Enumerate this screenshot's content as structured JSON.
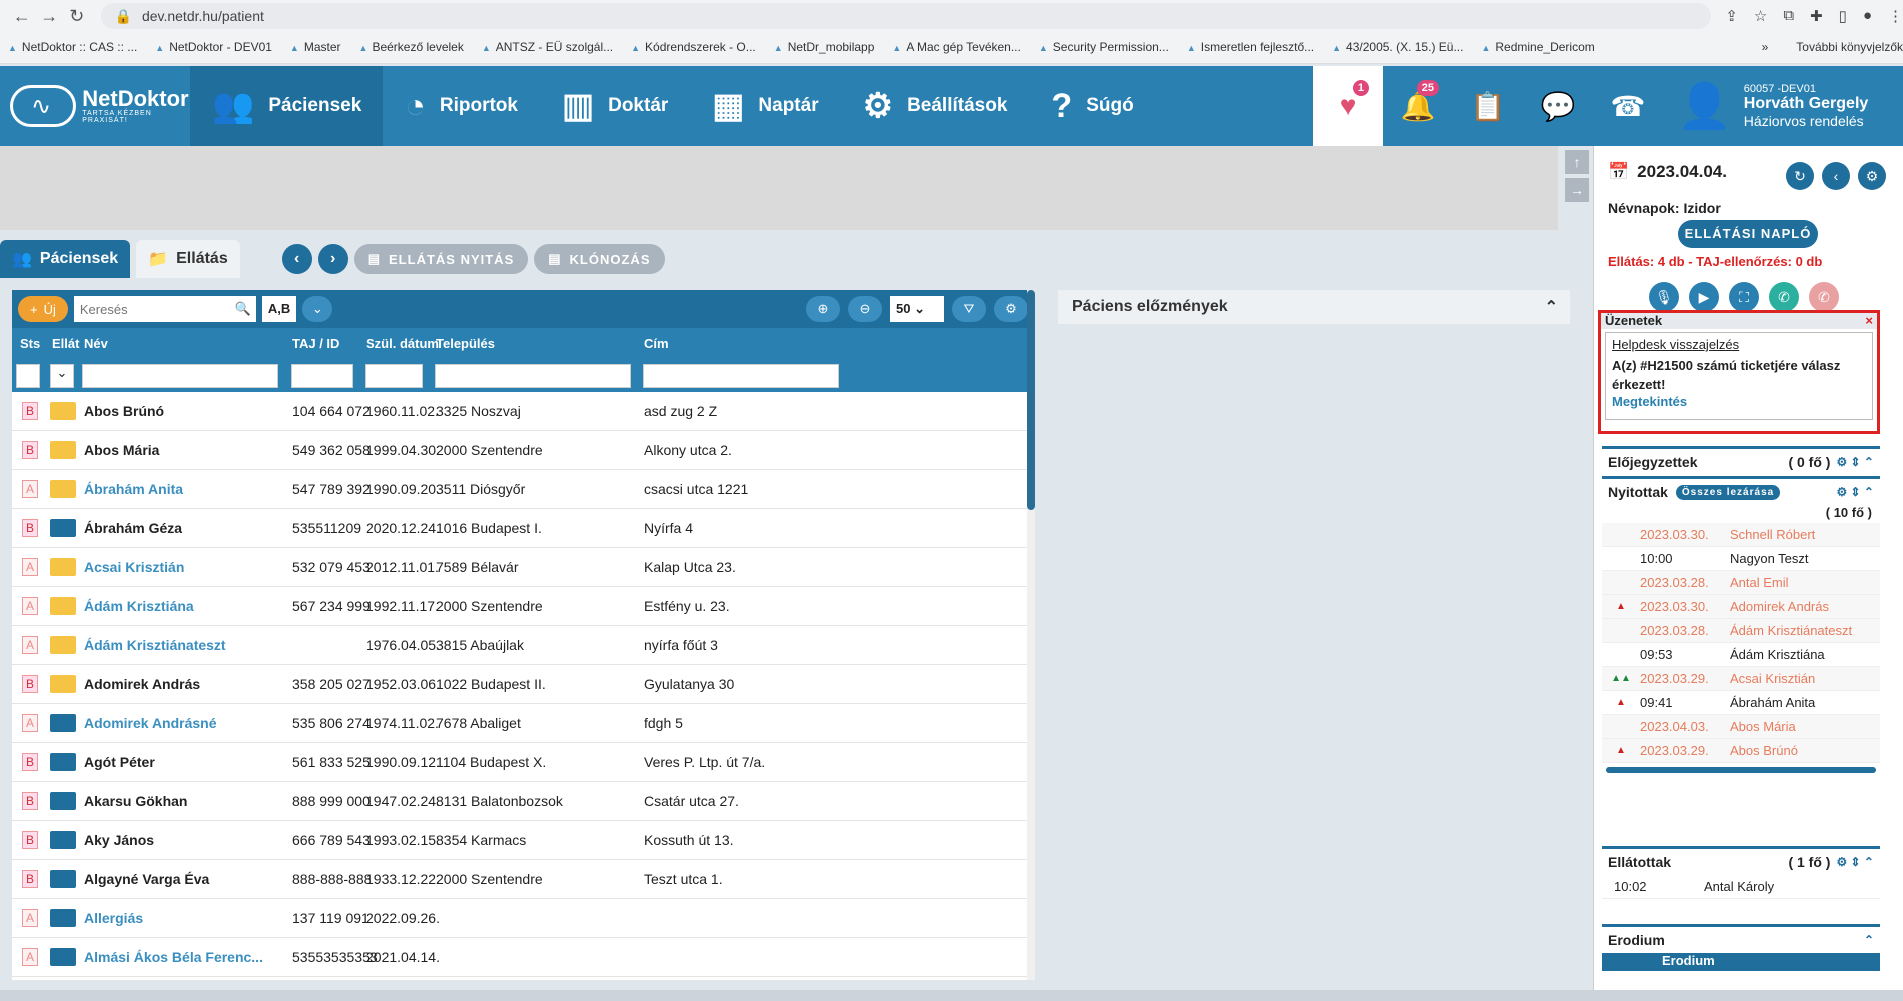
{
  "browser": {
    "url": "dev.netdr.hu/patient",
    "bookmarks": [
      "NetDoktor :: CAS :: ...",
      "NetDoktor - DEV01",
      "Master",
      "Beérkező levelek",
      "ANTSZ - EÜ szolgál...",
      "Kódrendszerek - O...",
      "NetDr_mobilapp",
      "A Mac gép Tevéken...",
      "Security Permission...",
      "Ismeretlen fejlesztő...",
      "43/2005. (X. 15.) Eü...",
      "Redmine_Dericom"
    ],
    "bookmarks_more": "»",
    "other_bookmarks": "További könyvjelzők"
  },
  "header": {
    "brand": "NetDoktor",
    "slogan": "TARTSA KÉZBEN PRAXISÁT!",
    "nav": [
      {
        "label": "Páciensek",
        "icon": "users-icon"
      },
      {
        "label": "Riportok",
        "icon": "pie-chart-icon"
      },
      {
        "label": "Doktár",
        "icon": "binders-icon"
      },
      {
        "label": "Naptár",
        "icon": "calendar-icon"
      },
      {
        "label": "Beállítások",
        "icon": "gears-icon"
      },
      {
        "label": "Súgó",
        "icon": "help-icon"
      }
    ],
    "badge_heart": "1",
    "badge_bell": "25",
    "user": {
      "line1": "60057 -DEV01",
      "name": "Horváth Gergely",
      "role": "Háziorvos rendelés"
    }
  },
  "tabs": {
    "patients": "Páciensek",
    "care": "Ellátás",
    "open_btn": "ELLÁTÁS NYITÁS",
    "clone_btn": "KLÓNOZÁS"
  },
  "toolbar": {
    "new_label": "Új",
    "search_placeholder": "Keresés",
    "ab_label": "A,B",
    "page_size": "50"
  },
  "columns": {
    "sts": "Sts",
    "ellat": "Ellát",
    "name": "Név",
    "taj": "TAJ / ID",
    "dob": "Szül. dátum",
    "city": "Település",
    "addr": "Cím"
  },
  "patients": [
    {
      "sts": "B",
      "folder": "yellow",
      "name": "Abos Brúnó",
      "link": false,
      "taj": "104 664 072",
      "dob": "1960.11.02.",
      "city": "3325 Noszvaj",
      "addr": "asd zug 2 Z"
    },
    {
      "sts": "B",
      "folder": "yellow",
      "name": "Abos Mária",
      "link": false,
      "taj": "549 362 058",
      "dob": "1999.04.30.",
      "city": "2000 Szentendre",
      "addr": "Alkony utca 2."
    },
    {
      "sts": "A",
      "folder": "yellow",
      "name": "Ábrahám Anita",
      "link": true,
      "taj": "547 789 392",
      "dob": "1990.09.20.",
      "city": "3511 Diósgyőr",
      "addr": "csacsi utca 1221"
    },
    {
      "sts": "B",
      "folder": "blue",
      "name": "Ábrahám Géza",
      "link": false,
      "taj": "535511209",
      "dob": "2020.12.24.",
      "city": "1016 Budapest I.",
      "addr": "Nyírfa 4"
    },
    {
      "sts": "A",
      "folder": "yellow",
      "name": "Acsai Krisztián",
      "link": true,
      "taj": "532 079 453",
      "dob": "2012.11.01.",
      "city": "7589 Bélavár",
      "addr": "Kalap Utca 23."
    },
    {
      "sts": "A",
      "folder": "yellow",
      "name": "Ádám Krisztiána",
      "link": true,
      "taj": "567 234 999",
      "dob": "1992.11.17.",
      "city": "2000 Szentendre",
      "addr": "Estfény u. 23."
    },
    {
      "sts": "A",
      "folder": "yellow",
      "name": "Ádám Krisztiánateszt",
      "link": true,
      "taj": "",
      "dob": "1976.04.05.",
      "city": "3815 Abaújlak",
      "addr": "nyírfa főút 3"
    },
    {
      "sts": "B",
      "folder": "yellow",
      "name": "Adomirek András",
      "link": false,
      "taj": "358 205 027",
      "dob": "1952.03.06.",
      "city": "1022 Budapest II.",
      "addr": "Gyulatanya 30"
    },
    {
      "sts": "A",
      "folder": "blue",
      "name": "Adomirek Andrásné",
      "link": true,
      "taj": "535 806 274",
      "dob": "1974.11.02.",
      "city": "7678 Abaliget",
      "addr": "fdgh 5"
    },
    {
      "sts": "B",
      "folder": "blue",
      "name": "Agót Péter",
      "link": false,
      "taj": "561 833 525",
      "dob": "1990.09.12.",
      "city": "1104 Budapest X.",
      "addr": "Veres P. Ltp. út 7/a."
    },
    {
      "sts": "B",
      "folder": "blue",
      "name": "Akarsu Gökhan",
      "link": false,
      "taj": "888 999 000",
      "dob": "1947.02.24.",
      "city": "8131 Balatonbozsok",
      "addr": "Csatár utca 27."
    },
    {
      "sts": "B",
      "folder": "blue",
      "name": "Aky János",
      "link": false,
      "taj": "666 789 543",
      "dob": "1993.02.15.",
      "city": "8354 Karmacs",
      "addr": "Kossuth út 13."
    },
    {
      "sts": "B",
      "folder": "blue",
      "name": "Algayné Varga Éva",
      "link": false,
      "taj": "888-888-888",
      "dob": "1933.12.22.",
      "city": "2000 Szentendre",
      "addr": "Teszt utca 1."
    },
    {
      "sts": "A",
      "folder": "blue",
      "name": "Allergiás",
      "link": true,
      "taj": "137 119 091",
      "dob": "2022.09.26.",
      "city": "",
      "addr": ""
    },
    {
      "sts": "A",
      "folder": "blue",
      "name": "Almási Ákos Béla Ferenc...",
      "link": true,
      "taj": "53553535353",
      "dob": "2021.04.14.",
      "city": "",
      "addr": ""
    }
  ],
  "history": {
    "title": "Páciens előzmények"
  },
  "right": {
    "date": "2023.04.04.",
    "nevnap": "Névnapok: Izidor",
    "naplo": "ELLÁTÁSI NAPLÓ",
    "ellatas": "Ellátás: 4 db - TAJ-ellenőrzés: 0 db",
    "messages": {
      "title": "Üzenetek",
      "subject": "Helpdesk visszajelzés",
      "body": "A(z) #H21500 számú ticketjére válasz érkezett!",
      "link": "Megtekintés"
    },
    "elojegyzett": {
      "title": "Előjegyzettek",
      "count": "( 0 fő )"
    },
    "nyitottak": {
      "title": "Nyitottak",
      "badge": "Összes lezárása",
      "count": "( 10 fő )"
    },
    "open_list": [
      {
        "flag": "",
        "time": "2023.03.30.",
        "name": "Schnell Róbert",
        "past": true
      },
      {
        "flag": "",
        "time": "10:00",
        "name": "Nagyon Teszt",
        "past": false
      },
      {
        "flag": "",
        "time": "2023.03.28.",
        "name": "Antal Emil",
        "past": true
      },
      {
        "flag": "▲",
        "time": "2023.03.30.",
        "name": "Adomirek András",
        "past": true
      },
      {
        "flag": "",
        "time": "2023.03.28.",
        "name": "Ádám Krisztiánateszt",
        "past": true
      },
      {
        "flag": "",
        "time": "09:53",
        "name": "Ádám Krisztiána",
        "past": false
      },
      {
        "flag": "▲▲",
        "time": "2023.03.29.",
        "name": "Acsai Krisztián",
        "past": true
      },
      {
        "flag": "▲",
        "time": "09:41",
        "name": "Ábrahám Anita",
        "past": false
      },
      {
        "flag": "",
        "time": "2023.04.03.",
        "name": "Abos Mária",
        "past": true
      },
      {
        "flag": "▲",
        "time": "2023.03.29.",
        "name": "Abos Brúnó",
        "past": true
      }
    ],
    "ellatottak": {
      "title": "Ellátottak",
      "count": "( 1 fő )",
      "time": "10:02",
      "name": "Antal Károly"
    },
    "erodium": {
      "title": "Erodium",
      "label": "Erodium"
    }
  }
}
